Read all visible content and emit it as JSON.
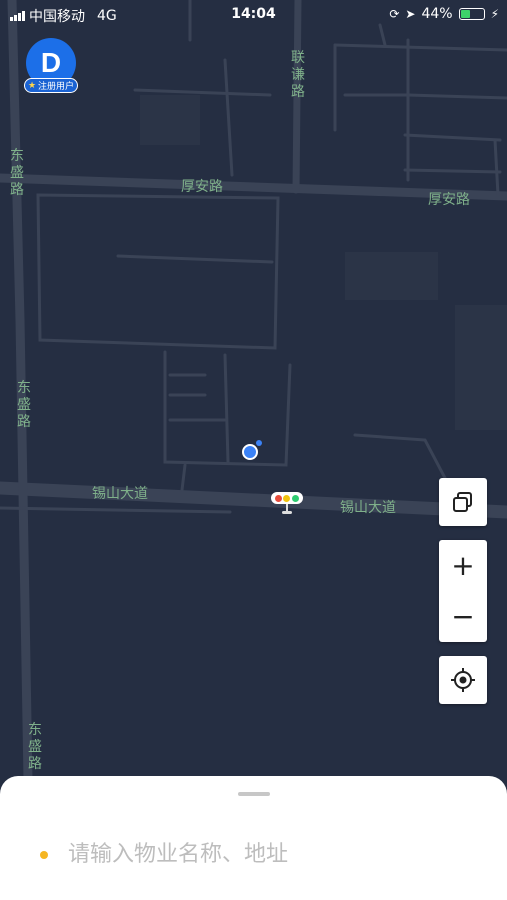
{
  "status_bar": {
    "carrier": "中国移动",
    "network": "4G",
    "time": "14:04",
    "battery": "44%",
    "battery_level": 0.44
  },
  "user": {
    "avatar_letter": "D",
    "badge": "注册用户"
  },
  "map": {
    "road_labels": {
      "lianqian": "联谦路",
      "houan_1": "厚安路",
      "houan_2": "厚安路",
      "dongsheng_1": "东盛路",
      "dongsheng_2": "东盛路",
      "dongsheng_3": "东盛路",
      "xishan_1": "锡山大道",
      "xishan_2": "锡山大道"
    },
    "colors": {
      "background": "#252e42",
      "road": "#3a4356",
      "label": "#7fb08a",
      "location": "#3b82f6"
    }
  },
  "controls": {
    "zoom_in": "+",
    "zoom_out": "−"
  },
  "search": {
    "placeholder": "请输入物业名称、地址"
  }
}
